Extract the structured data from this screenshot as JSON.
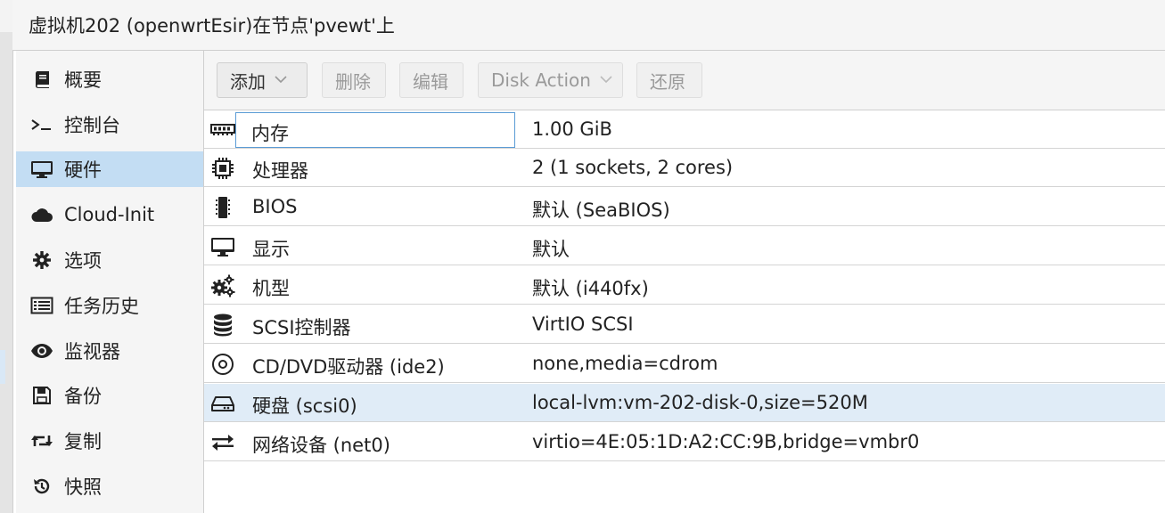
{
  "title": "虚拟机202 (openwrtEsir)在节点'pvewt'上",
  "sidebar": {
    "items": [
      {
        "label": "概要",
        "icon": "book-icon"
      },
      {
        "label": "控制台",
        "icon": "terminal-icon"
      },
      {
        "label": "硬件",
        "icon": "monitor-icon",
        "selected": true
      },
      {
        "label": "Cloud-Init",
        "icon": "cloud-icon"
      },
      {
        "label": "选项",
        "icon": "gear-icon"
      },
      {
        "label": "任务历史",
        "icon": "list-icon"
      },
      {
        "label": "监视器",
        "icon": "eye-icon"
      },
      {
        "label": "备份",
        "icon": "floppy-icon"
      },
      {
        "label": "复制",
        "icon": "retweet-icon"
      },
      {
        "label": "快照",
        "icon": "history-icon"
      }
    ]
  },
  "toolbar": {
    "add_label": "添加",
    "delete_label": "删除",
    "edit_label": "编辑",
    "disk_action_label": "Disk Action",
    "revert_label": "还原"
  },
  "hardware": {
    "rows": [
      {
        "name": "内存",
        "value": "1.00 GiB",
        "icon": "memory-icon"
      },
      {
        "name": "处理器",
        "value": "2 (1 sockets, 2 cores)",
        "icon": "cpu-icon"
      },
      {
        "name": "BIOS",
        "value": "默认 (SeaBIOS)",
        "icon": "microchip-icon"
      },
      {
        "name": "显示",
        "value": "默认",
        "icon": "desktop-icon"
      },
      {
        "name": "机型",
        "value": "默认 (i440fx)",
        "icon": "cogs-icon"
      },
      {
        "name": "SCSI控制器",
        "value": "VirtIO SCSI",
        "icon": "database-icon"
      },
      {
        "name": "CD/DVD驱动器 (ide2)",
        "value": "none,media=cdrom",
        "icon": "cdrom-icon"
      },
      {
        "name": "硬盘 (scsi0)",
        "value": "local-lvm:vm-202-disk-0,size=520M",
        "icon": "harddisk-icon",
        "selected": true
      },
      {
        "name": "网络设备 (net0)",
        "value": "virtio=4E:05:1D:A2:CC:9B,bridge=vmbr0",
        "icon": "exchange-icon"
      }
    ]
  },
  "colors": {
    "selected_nav": "#c3ddf3",
    "selected_row": "#e0ecf7",
    "focus_border": "#5a9bd5"
  }
}
